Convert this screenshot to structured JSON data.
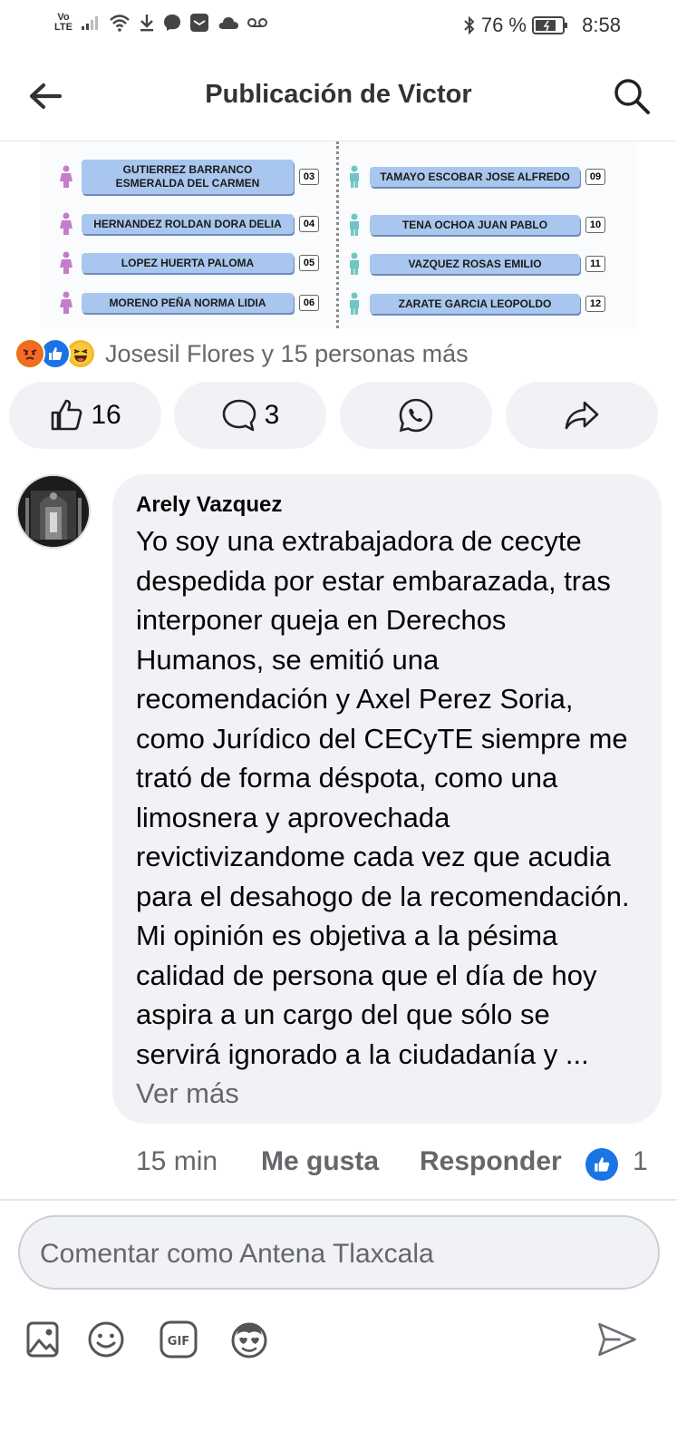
{
  "status_bar": {
    "carrier": "Vo\nLTE",
    "battery": "76 %",
    "time": "8:58"
  },
  "header": {
    "title": "Publicación de Victor"
  },
  "post_image": {
    "left_list": [
      {
        "name": "GUTIERREZ BARRANCO\nESMERALDA DEL CARMEN",
        "num": "03"
      },
      {
        "name": "HERNANDEZ ROLDAN DORA DELIA",
        "num": "04"
      },
      {
        "name": "LOPEZ HUERTA PALOMA",
        "num": "05"
      },
      {
        "name": "MORENO PEÑA NORMA LIDIA",
        "num": "06"
      }
    ],
    "right_list": [
      {
        "name": "TAMAYO ESCOBAR JOSE ALFREDO",
        "num": "09"
      },
      {
        "name": "TENA OCHOA JUAN PABLO",
        "num": "10"
      },
      {
        "name": "VAZQUEZ ROSAS EMILIO",
        "num": "11"
      },
      {
        "name": "ZARATE GARCIA LEOPOLDO",
        "num": "12"
      }
    ],
    "colors": {
      "female": "#c47ec9",
      "male": "#6fc6c2",
      "name_bg": "#a9c7ee"
    }
  },
  "reactions": {
    "icons": [
      "angry-icon",
      "like-icon",
      "haha-icon"
    ],
    "summary": "Josesil Flores y 15 personas más"
  },
  "actions": {
    "like_count": "16",
    "comment_count": "3"
  },
  "comment": {
    "author": "Arely Vazquez",
    "text": "Yo soy una extrabajadora de cecyte despedida por estar embarazada, tras interponer queja en Derechos Humanos, se emitió una recomendación y Axel Perez Soria, como Jurídico del CECyTE siempre me trató de forma déspota, como una limosnera y aprovechada revictivizandome cada vez que acudia para el desahogo de la recomendación. Mi opinión es objetiva a la pésima calidad de persona que el día de hoy aspira a un cargo del que sólo se servirá ignorado a la ciudadanía y ...",
    "see_more": "Ver más",
    "time": "15 min",
    "like_label": "Me gusta",
    "reply_label": "Responder",
    "reaction_count": "1"
  },
  "composer": {
    "placeholder": "Comentar como Antena Tlaxcala"
  },
  "colors": {
    "accent": "#1b74e4",
    "bubble": "#f0f2f5",
    "muted": "#65676b"
  }
}
